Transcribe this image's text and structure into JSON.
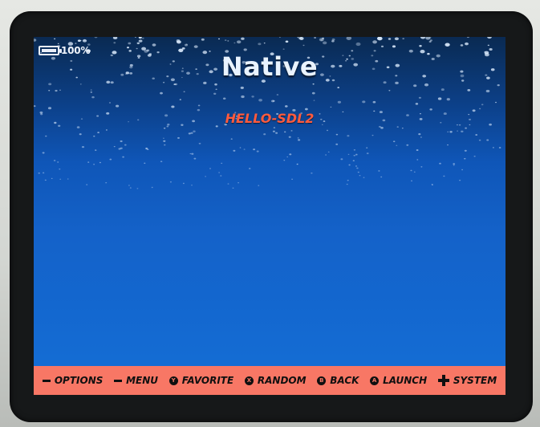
{
  "status": {
    "battery_percent": 100,
    "battery_text": "100%"
  },
  "header": {
    "title": "Native"
  },
  "selection": {
    "game": "HELLO-SDL2"
  },
  "footer": {
    "items": [
      {
        "glyph": "bar",
        "label": "OPTIONS"
      },
      {
        "glyph": "bar",
        "label": "MENU"
      },
      {
        "glyph": "circle",
        "letter": "Y",
        "label": "FAVORITE"
      },
      {
        "glyph": "circle",
        "letter": "X",
        "label": "RANDOM"
      },
      {
        "glyph": "circle",
        "letter": "B",
        "label": "BACK"
      },
      {
        "glyph": "circle",
        "letter": "A",
        "label": "LAUNCH"
      },
      {
        "glyph": "dpad",
        "label": "SYSTEM"
      }
    ]
  },
  "colors": {
    "footer_bg": "#f87765",
    "title_text": "#e9f3ff",
    "game_text": "#ff5b3e",
    "screen_top": "#0a2a52",
    "screen_bottom": "#156fd6"
  },
  "icons": {
    "battery": "battery-icon",
    "options": "minus-button-icon",
    "menu": "minus-button-icon",
    "favorite": "y-button-icon",
    "random": "x-button-icon",
    "back": "b-button-icon",
    "launch": "a-button-icon",
    "system": "dpad-icon"
  }
}
